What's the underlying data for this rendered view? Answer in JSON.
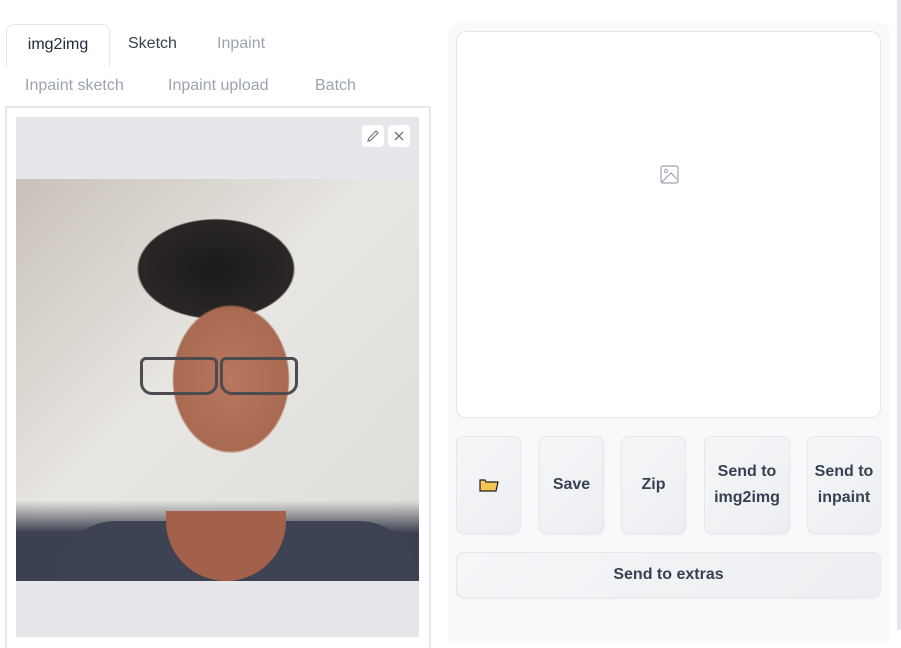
{
  "tabs": [
    {
      "label": "img2img",
      "active": true
    },
    {
      "label": "Sketch",
      "active": false
    },
    {
      "label": "Inpaint",
      "active": false
    },
    {
      "label": "Inpaint sketch",
      "active": false
    },
    {
      "label": "Inpaint upload",
      "active": false
    },
    {
      "label": "Batch",
      "active": false
    }
  ],
  "editor": {
    "image_alt": "Uploaded photo of a person with glasses",
    "edit_icon": "pencil-icon",
    "clear_icon": "close-icon"
  },
  "output": {
    "placeholder_icon": "image-icon"
  },
  "buttons": {
    "folder_icon": "folder-icon",
    "folder_glyph": "📂",
    "save": "Save",
    "zip": "Zip",
    "send_img2img": "Send to img2img",
    "send_inpaint": "Send to inpaint",
    "send_extras": "Send to extras"
  },
  "colors": {
    "folder": "#f6c652",
    "tab_inactive": "#9ca3af",
    "text": "#374151"
  }
}
